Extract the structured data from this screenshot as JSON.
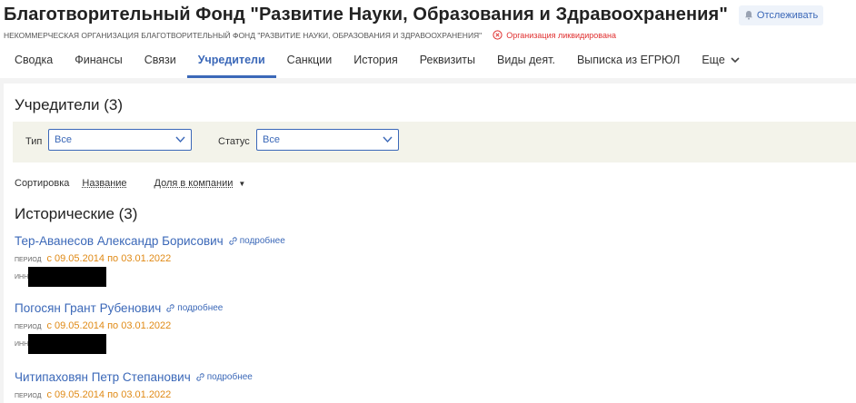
{
  "header": {
    "title": "Благотворительный Фонд \"Развитие Науки, Образования и Здравоохранения\"",
    "follow_label": "Отслеживать",
    "subtitle": "НЕКОММЕРЧЕСКАЯ ОРГАНИЗАЦИЯ БЛАГОТВОРИТЕЛЬНЫЙ ФОНД \"РАЗВИТИЕ НАУКИ, ОБРАЗОВАНИЯ И ЗДРАВООХРАНЕНИЯ\"",
    "status": "Организация ликвидирована"
  },
  "tabs": [
    {
      "label": "Сводка"
    },
    {
      "label": "Финансы"
    },
    {
      "label": "Связи"
    },
    {
      "label": "Учредители"
    },
    {
      "label": "Санкции"
    },
    {
      "label": "История"
    },
    {
      "label": "Реквизиты"
    },
    {
      "label": "Виды деят."
    },
    {
      "label": "Выписка из ЕГРЮЛ"
    },
    {
      "label": "Еще"
    }
  ],
  "active_tab": "Учредители",
  "section": {
    "title": "Учредители (3)",
    "filters": {
      "type_label": "Тип",
      "type_value": "Все",
      "status_label": "Статус",
      "status_value": "Все"
    },
    "sort": {
      "label": "Сортировка",
      "by_name": "Название",
      "by_share": "Доля в компании"
    },
    "historical_title": "Исторические (3)",
    "founders": [
      {
        "name": "Тер-Аванесов Александр Борисович",
        "more": "подробнее",
        "period_label": "ПЕРИОД",
        "period": "с 09.05.2014 по 03.01.2022",
        "inn_label": "ИНН"
      },
      {
        "name": "Погосян Грант Рубенович",
        "more": "подробнее",
        "period_label": "ПЕРИОД",
        "period": "с 09.05.2014 по 03.01.2022",
        "inn_label": "ИНН"
      },
      {
        "name": "Читипаховян Петр Степанович",
        "more": "подробнее",
        "period_label": "ПЕРИОД",
        "period": "с 09.05.2014 по 03.01.2022",
        "inn_label": "ИНН"
      }
    ]
  },
  "colors": {
    "accent": "#3b68b8",
    "period": "#e08a16",
    "danger": "#e03030",
    "filter_bg": "#f3f3ea"
  },
  "icons": {
    "follow": "bell-icon",
    "status": "circle-x-icon",
    "more": "link-icon",
    "dropdown": "chevron-down-icon"
  }
}
